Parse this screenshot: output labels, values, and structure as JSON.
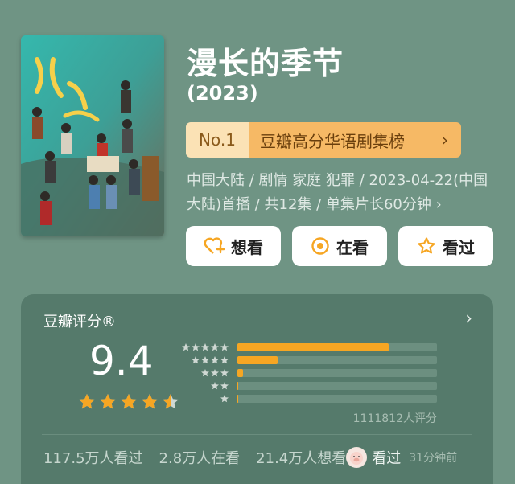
{
  "movie": {
    "title": "漫长的季节",
    "year": "(2023)"
  },
  "ranking": {
    "number": "No.1",
    "list_name": "豆瓣高分华语剧集榜",
    "chevron": "›"
  },
  "meta": {
    "line": "中国大陆 / 剧情 家庭 犯罪 / 2023-04-22(中国大陆)首播 / 共12集 / 单集片长60分钟",
    "chevron": "›"
  },
  "actions": {
    "want": "想看",
    "doing": "在看",
    "done": "看过"
  },
  "rating": {
    "label": "豆瓣评分®",
    "chevron": "›",
    "score": "9.4",
    "stars_value": 4.5,
    "distribution_percent": [
      76,
      20,
      3,
      0.5,
      0.2
    ],
    "total": "1111812人评分"
  },
  "stats": {
    "watched": "117.5万人看过",
    "watching": "2.8万人在看",
    "wish": "21.4万人想看",
    "my_status": "看过",
    "time": "31分钟前"
  },
  "colors": {
    "background": "#6f9484",
    "card": "#557a6b",
    "accent": "#f6a623",
    "rank_light": "#fbe2b5",
    "rank_dark": "#f6b965"
  },
  "icons": {
    "want": "heart-plus-icon",
    "doing": "target-icon",
    "done": "star-outline-icon",
    "avatar": "pig-avatar-icon"
  }
}
